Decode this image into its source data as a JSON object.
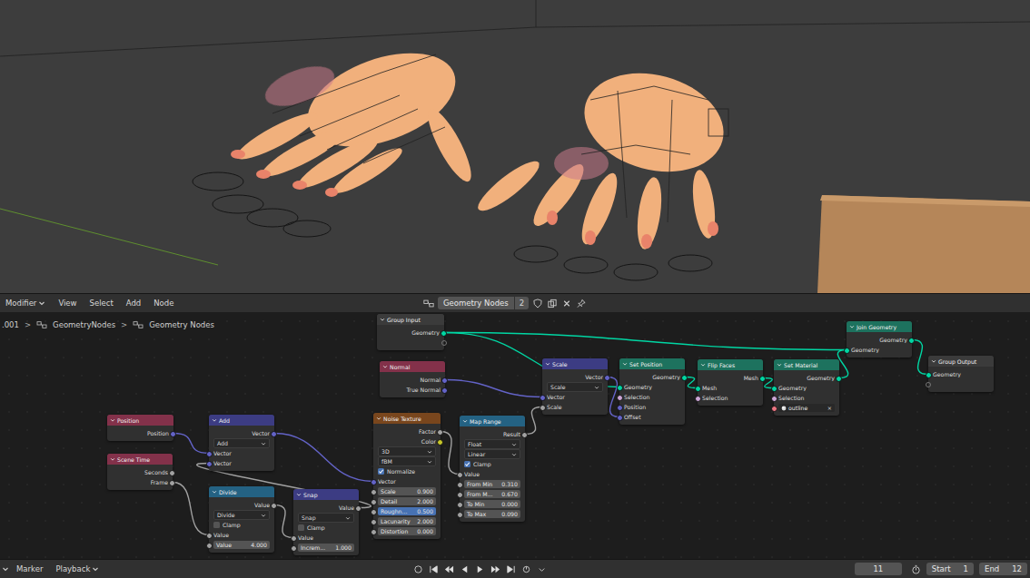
{
  "header": {
    "editor_type": "Modifier",
    "menus": [
      "View",
      "Select",
      "Add",
      "Node"
    ],
    "tree_name": "Geometry Nodes",
    "users": "2"
  },
  "breadcrumb": {
    "separator": ">",
    "items": [
      ".001",
      "GeometryNodes",
      "Geometry Nodes"
    ]
  },
  "nodes": [
    {
      "title": "Group Input",
      "kind": "group",
      "rows": [
        {
          "kind": "output",
          "label": "Geometry",
          "socket": "geometry"
        },
        {
          "kind": "empty-output"
        }
      ]
    },
    {
      "title": "Normal",
      "kind": "input",
      "rows": [
        {
          "kind": "output",
          "label": "Normal",
          "socket": "vector"
        },
        {
          "kind": "output",
          "label": "True Normal",
          "socket": "vector"
        }
      ]
    },
    {
      "title": "Position",
      "kind": "input",
      "rows": [
        {
          "kind": "output",
          "label": "Position",
          "socket": "vector"
        }
      ]
    },
    {
      "title": "Scene Time",
      "kind": "input",
      "rows": [
        {
          "kind": "output",
          "label": "Seconds",
          "socket": "float"
        },
        {
          "kind": "output",
          "label": "Frame",
          "socket": "float"
        }
      ]
    },
    {
      "title": "Add",
      "kind": "vector",
      "rows": [
        {
          "kind": "output",
          "label": "Vector",
          "socket": "vector"
        },
        {
          "kind": "dropdown",
          "value": "Add"
        },
        {
          "kind": "input",
          "label": "Vector",
          "socket": "vector",
          "links": [
            {
              "from": "Position",
              "output": "Position"
            }
          ]
        },
        {
          "kind": "input",
          "label": "Vector",
          "socket": "vector",
          "links": [
            {
              "from": "Snap",
              "output": "Value"
            }
          ]
        }
      ]
    },
    {
      "title": "Divide",
      "kind": "converter",
      "rows": [
        {
          "kind": "output",
          "label": "Value",
          "socket": "float"
        },
        {
          "kind": "dropdown",
          "value": "Divide"
        },
        {
          "kind": "checkbox",
          "label": "Clamp",
          "checked": false
        },
        {
          "kind": "input",
          "label": "Value",
          "socket": "float",
          "links": [
            {
              "from": "Scene Time",
              "output": "Frame"
            }
          ]
        },
        {
          "kind": "field",
          "label": "Value",
          "value": "4.000",
          "socket": "float",
          "selected": false
        }
      ]
    },
    {
      "title": "Snap",
      "kind": "vector",
      "rows": [
        {
          "kind": "output",
          "label": "Value",
          "socket": "float"
        },
        {
          "kind": "dropdown",
          "value": "Snap"
        },
        {
          "kind": "checkbox",
          "label": "Clamp",
          "checked": false
        },
        {
          "kind": "input",
          "label": "Value",
          "socket": "float",
          "links": [
            {
              "from": "Divide",
              "output": "Value"
            }
          ]
        },
        {
          "kind": "field",
          "label": "Increm...",
          "value": "1.000",
          "socket": "float",
          "selected": false
        }
      ]
    },
    {
      "title": "Noise Texture",
      "kind": "texture",
      "rows": [
        {
          "kind": "output",
          "label": "Factor",
          "socket": "float"
        },
        {
          "kind": "output",
          "label": "Color",
          "socket": "color"
        },
        {
          "kind": "dropdown",
          "value": "3D"
        },
        {
          "kind": "dropdown",
          "value": "fBM"
        },
        {
          "kind": "checkbox",
          "label": "Normalize",
          "checked": true
        },
        {
          "kind": "input",
          "label": "Vector",
          "socket": "vector",
          "links": [
            {
              "from": "Add",
              "output": "Vector"
            }
          ]
        },
        {
          "kind": "field",
          "label": "Scale",
          "value": "0.900",
          "socket": "float",
          "selected": false
        },
        {
          "kind": "field",
          "label": "Detail",
          "value": "2.000",
          "socket": "float",
          "selected": false
        },
        {
          "kind": "field",
          "label": "Roughn...",
          "value": "0.500",
          "socket": "float",
          "selected": true
        },
        {
          "kind": "field",
          "label": "Lacunarity",
          "value": "2.000",
          "socket": "float",
          "selected": false
        },
        {
          "kind": "field",
          "label": "Distortion",
          "value": "0.000",
          "socket": "float",
          "selected": false
        }
      ]
    },
    {
      "title": "Map Range",
      "kind": "converter",
      "rows": [
        {
          "kind": "output",
          "label": "Result",
          "socket": "float"
        },
        {
          "kind": "dropdown",
          "value": "Float"
        },
        {
          "kind": "dropdown",
          "value": "Linear"
        },
        {
          "kind": "checkbox",
          "label": "Clamp",
          "checked": true
        },
        {
          "kind": "input",
          "label": "Value",
          "socket": "float",
          "links": [
            {
              "from": "Noise Texture",
              "output": "Factor"
            }
          ]
        },
        {
          "kind": "field",
          "label": "From Min",
          "value": "0.310",
          "socket": "float",
          "selected": false
        },
        {
          "kind": "field",
          "label": "From M...",
          "value": "0.670",
          "socket": "float",
          "selected": false
        },
        {
          "kind": "field",
          "label": "To Min",
          "value": "0.000",
          "socket": "float",
          "selected": false
        },
        {
          "kind": "field",
          "label": "To Max",
          "value": "0.090",
          "socket": "float",
          "selected": false
        }
      ]
    },
    {
      "title": "Scale",
      "kind": "vector",
      "rows": [
        {
          "kind": "output",
          "label": "Vector",
          "socket": "vector"
        },
        {
          "kind": "dropdown",
          "value": "Scale"
        },
        {
          "kind": "input",
          "label": "Vector",
          "socket": "vector",
          "links": [
            {
              "from": "Normal",
              "output": "Normal"
            }
          ]
        },
        {
          "kind": "input",
          "label": "Scale",
          "socket": "float",
          "links": [
            {
              "from": "Map Range",
              "output": "Result"
            }
          ]
        }
      ]
    },
    {
      "title": "Set Position",
      "kind": "geometry",
      "rows": [
        {
          "kind": "output",
          "label": "Geometry",
          "socket": "geometry"
        },
        {
          "kind": "input",
          "label": "Geometry",
          "socket": "geometry",
          "links": [
            {
              "from": "Group Input",
              "output": "Geometry"
            }
          ]
        },
        {
          "kind": "input",
          "label": "Selection",
          "socket": "bool",
          "links": []
        },
        {
          "kind": "input",
          "label": "Position",
          "socket": "vector",
          "links": []
        },
        {
          "kind": "input",
          "label": "Offset",
          "socket": "vector",
          "links": [
            {
              "from": "Scale",
              "output": "Vector"
            }
          ]
        }
      ]
    },
    {
      "title": "Flip Faces",
      "kind": "geometry",
      "rows": [
        {
          "kind": "output",
          "label": "Mesh",
          "socket": "geometry"
        },
        {
          "kind": "input",
          "label": "Mesh",
          "socket": "geometry",
          "links": [
            {
              "from": "Set Position",
              "output": "Geometry"
            }
          ]
        },
        {
          "kind": "input",
          "label": "Selection",
          "socket": "bool",
          "links": []
        }
      ]
    },
    {
      "title": "Set Material",
      "kind": "geometry",
      "rows": [
        {
          "kind": "output",
          "label": "Geometry",
          "socket": "geometry"
        },
        {
          "kind": "input",
          "label": "Geometry",
          "socket": "geometry",
          "links": [
            {
              "from": "Flip Faces",
              "output": "Mesh"
            }
          ]
        },
        {
          "kind": "input",
          "label": "Selection",
          "socket": "bool",
          "links": []
        },
        {
          "kind": "material",
          "value": "outline",
          "clear": "×",
          "socket": "material"
        }
      ]
    },
    {
      "title": "Join Geometry",
      "kind": "geometry",
      "rows": [
        {
          "kind": "output",
          "label": "Geometry",
          "socket": "geometry"
        },
        {
          "kind": "input",
          "label": "Geometry",
          "socket": "geometry",
          "links": [
            {
              "from": "Group Input",
              "output": "Geometry"
            },
            {
              "from": "Set Material",
              "output": "Geometry"
            }
          ]
        }
      ]
    },
    {
      "title": "Group Output",
      "kind": "group",
      "rows": [
        {
          "kind": "input",
          "label": "Geometry",
          "socket": "geometry",
          "links": [
            {
              "from": "Join Geometry",
              "output": "Geometry"
            }
          ]
        },
        {
          "kind": "empty-input"
        }
      ]
    }
  ],
  "timeline": {
    "menus": [
      {
        "label": "Marker",
        "dropdown": false
      },
      {
        "label": "Playback",
        "dropdown": true
      }
    ],
    "frame": "11",
    "start": {
      "label": "Start",
      "value": "1"
    },
    "end": {
      "label": "End",
      "value": "12"
    }
  }
}
